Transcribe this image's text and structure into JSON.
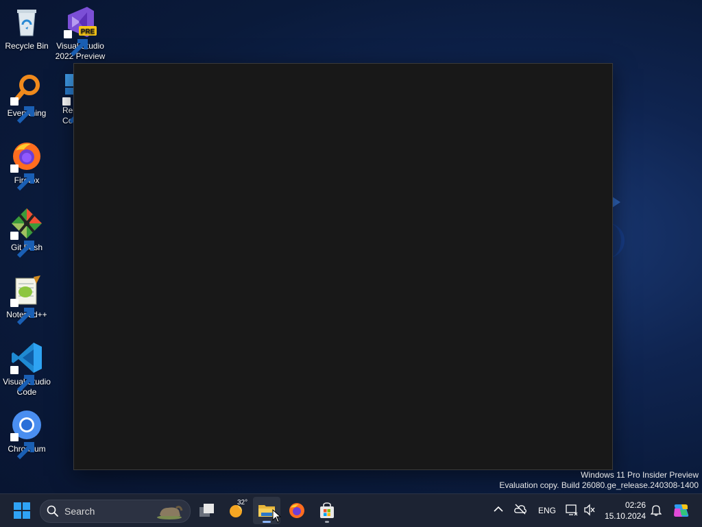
{
  "desktop": {
    "icons": [
      {
        "label": "Recycle Bin",
        "icon": "recycle-bin-icon"
      },
      {
        "label": "Visual Studio 2022 Preview",
        "icon": "visual-studio-preview-icon",
        "badge": "PRE"
      },
      {
        "label": "Everything",
        "icon": "everything-search-icon"
      },
      {
        "label": "Rec Co",
        "icon": "partially-hidden-app-icon"
      },
      {
        "label": "Firefox",
        "icon": "firefox-icon"
      },
      {
        "label": "Git Bash",
        "icon": "git-bash-icon"
      },
      {
        "label": "Notepad++",
        "icon": "notepadpp-icon"
      },
      {
        "label": "Visual Studio Code",
        "icon": "vscode-icon"
      },
      {
        "label": "Chromium",
        "icon": "chromium-icon"
      }
    ]
  },
  "window": {
    "title": "",
    "state": "blank dark window"
  },
  "watermark": {
    "line1": "Windows 11 Pro Insider Preview",
    "line2": "Evaluation copy. Build 26080.ge_release.240308-1400"
  },
  "taskbar": {
    "start": "windows-start-icon",
    "search_placeholder": "Search",
    "weather_temp": "32°",
    "apps": [
      "task-view-icon",
      "weather-icon",
      "file-explorer-icon",
      "firefox-icon",
      "microsoft-store-icon"
    ],
    "tray": {
      "language": "ENG",
      "time": "02:26",
      "date": "15.10.2024"
    }
  },
  "colors": {
    "accent": "#0078d4",
    "taskbar_bg": "#1c2333",
    "window_bg": "#181818"
  }
}
